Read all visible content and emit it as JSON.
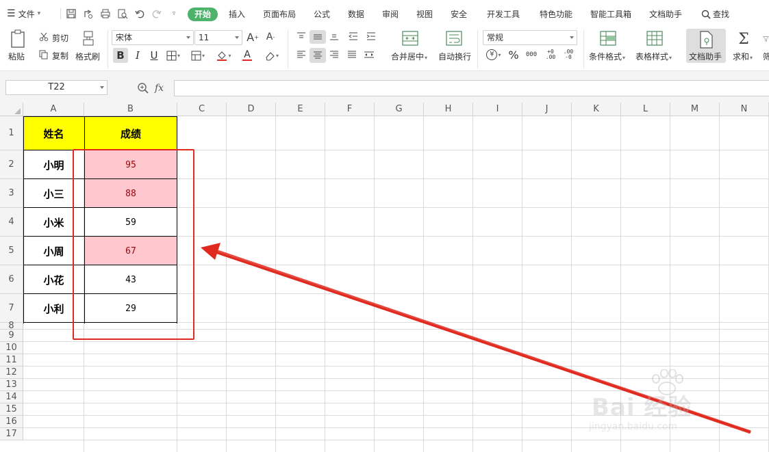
{
  "menu": {
    "file_label": "文件",
    "tabs": [
      "开始",
      "插入",
      "页面布局",
      "公式",
      "数据",
      "审阅",
      "视图",
      "安全",
      "开发工具",
      "特色功能",
      "智能工具箱",
      "文档助手"
    ],
    "search_label": "查找"
  },
  "ribbon": {
    "paste": "粘贴",
    "cut": "剪切",
    "copy": "复制",
    "format_painter": "格式刷",
    "font_name": "宋体",
    "font_size": "11",
    "bold": "B",
    "italic": "I",
    "underline": "U",
    "merge_center": "合并居中",
    "wrap_text": "自动换行",
    "number_format": "常规",
    "percent": "%",
    "thousands": "000",
    "inc_decimal": "+0 .00",
    "dec_decimal": ".00 -0",
    "conditional_format": "条件格式",
    "table_style": "表格样式",
    "doc_helper": "文档助手",
    "sum": "求和",
    "filter_partial": "筛"
  },
  "formula_bar": {
    "name_box": "T22",
    "fx_label": "fx",
    "value": ""
  },
  "sheet": {
    "columns": [
      "A",
      "B",
      "C",
      "D",
      "E",
      "F",
      "G",
      "H",
      "I",
      "J",
      "K",
      "L",
      "M",
      "N"
    ],
    "rows": [
      "1",
      "2",
      "3",
      "4",
      "5",
      "6",
      "7",
      "8",
      "9",
      "10",
      "11",
      "12",
      "13",
      "14",
      "15",
      "16",
      "17"
    ],
    "header": {
      "a1": "姓名",
      "b1": "成绩"
    },
    "records": [
      {
        "name": "小明",
        "score": "95",
        "highlight": true
      },
      {
        "name": "小三",
        "score": "88",
        "highlight": true
      },
      {
        "name": "小米",
        "score": "59",
        "highlight": false
      },
      {
        "name": "小周",
        "score": "67",
        "highlight": true
      },
      {
        "name": "小花",
        "score": "43",
        "highlight": false
      },
      {
        "name": "小利",
        "score": "29",
        "highlight": false
      }
    ]
  },
  "colors": {
    "header_fill": "#ffff00",
    "highlight_fill": "#ffc7ce",
    "highlight_text": "#9c0006",
    "annotation_red": "#e02a20",
    "active_tab": "#4db36a"
  },
  "watermark": {
    "brand": "Bai 经验",
    "url": "jingyan.baidu.com"
  }
}
